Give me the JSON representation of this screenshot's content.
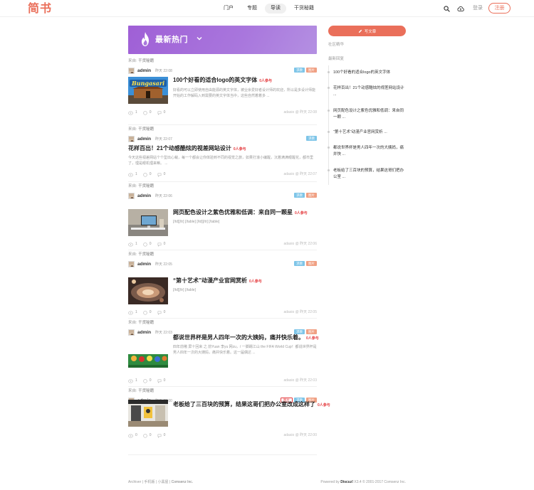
{
  "header": {
    "logo": "简书",
    "nav": [
      "门户",
      "专题",
      "导读",
      "干货秘籍"
    ],
    "active_nav": 2,
    "login": "登录",
    "register": "注册"
  },
  "banner": {
    "title": "最新热门"
  },
  "posts": [
    {
      "source_prefix": "来自: ",
      "source": "干货秘籍",
      "author": "admin",
      "time": "昨天 22:08",
      "tags": [
        {
          "text": "求教",
          "style": "blue"
        },
        {
          "text": "图片",
          "style": "orange"
        }
      ],
      "title": "100个好看的适合logo的英文字体",
      "hot": "0人参与",
      "excerpt": "好看的可以立即使用自由能源的英文字体，被业余爱好者设计师的欢迎，所以是多设计师能开始的工作解码入到需要的英文字体当中，这些自然着着多 ...",
      "likes": "1",
      "comments": "0",
      "views": "0",
      "footer": "adasio @ 昨天 22:08",
      "thumb": "bungasari"
    },
    {
      "source_prefix": "来自: ",
      "source": "干货秘籍",
      "author": "admin",
      "time": "昨天 22:07",
      "tags": [
        {
          "text": "求教",
          "style": "blue"
        }
      ],
      "title": "花样百出！21个动感酷炫的视差网站设计",
      "hot": "0人参与",
      "excerpt": "今天这些视差网站个个型出心裁，每一个都会让你体验到不同的视觉之旅，如果打滚小编醒，沉着满满眼醒花，都市里了，理是眼机理来嘛。 ...",
      "likes": "1",
      "comments": "0",
      "views": "0",
      "footer": "adasio @ 昨天 22:07",
      "thumb": ""
    },
    {
      "source_prefix": "来自: ",
      "source": "干货秘籍",
      "author": "admin",
      "time": "昨天 22:06",
      "tags": [
        {
          "text": "求教",
          "style": "blue"
        },
        {
          "text": "图片",
          "style": "orange"
        }
      ],
      "title": "网页配色设计之紫色优雅和低调：来自同一颗星",
      "hot": "0人参与",
      "excerpt": "[/td][/tr] [/table] [/td][/tr] [/table]",
      "likes": "1",
      "comments": "0",
      "views": "0",
      "footer": "adasio @ 昨天 22:06",
      "thumb": "office"
    },
    {
      "source_prefix": "来自: ",
      "source": "干货秘籍",
      "author": "admin",
      "time": "昨天 22:05",
      "tags": [
        {
          "text": "求教",
          "style": "blue"
        },
        {
          "text": "图片",
          "style": "orange"
        }
      ],
      "title": "“第十艺术”动漫产业官网赏析",
      "hot": "0人参与",
      "excerpt": "[/td][/tr] [/table]",
      "likes": "1",
      "comments": "0",
      "views": "0",
      "footer": "adasio @ 昨天 22:05",
      "thumb": "anime"
    },
    {
      "source_prefix": "来自: ",
      "source": "干货秘籍",
      "author": "admin",
      "time": "昨天 22:03",
      "tags": [
        {
          "text": "求教",
          "style": "blue"
        },
        {
          "text": "图片",
          "style": "orange"
        }
      ],
      "title": "都说世界杯是男人四年一次的大姨妈，痛并快乐着。",
      "hot": "0人参与",
      "excerpt": "四年前嗷 屏十回来 之 前Yuan 李yu 网zu，/ 一脚踢江山 the FIFA World Cup！都说世界杯是男人四年一次的大姨妈，痛并快乐着。这一届偶达 ...",
      "likes": "1",
      "comments": "0",
      "views": "0",
      "footer": "adasio @ 昨天 22:03",
      "thumb": "worldcup"
    },
    {
      "source_prefix": "来自: ",
      "source": "干货秘籍",
      "author": "admin",
      "time": "昨天 22:00",
      "tags": [
        {
          "text": "图片",
          "style": "red-outline"
        },
        {
          "text": "求教",
          "style": "blue"
        },
        {
          "text": "图片",
          "style": "orange"
        }
      ],
      "title": "老板给了三百块的预算，结果这哥们把办公室改成这样了",
      "hot": "0人参与",
      "excerpt": "",
      "likes": "0",
      "comments": "0",
      "views": "0",
      "footer": "adasio @ 昨天 22:00",
      "thumb": "interior"
    }
  ],
  "sidebar": {
    "write_label": "写文章",
    "community_title": "社区精华",
    "recent_title": "最新回复",
    "recent": [
      "100个好看的适合logo的英文字体",
      "花样百出！21个动感酷炫的视差网站设计 ...",
      "网页配色设计之紫色优雅和低调：来自同一颗 ...",
      "“第十艺术”动漫产业官网赏析 ...",
      "都说世界杯是男人四年一次的大姨妈，痛并快 ...",
      "老板给了三百块的预算，结果这哥们把办公室 ..."
    ]
  },
  "footer": {
    "left_links": "Archiver | 手机版 | 小黑屋 | ",
    "left_brand": "Comsenz Inc.",
    "right_prefix": "Powered by ",
    "right_brand": "Discuz!",
    "right_suffix": " X3.4 © 2001-2017 Comsenz Inc."
  },
  "thumb_text": {
    "bungasari": "Bungasari"
  },
  "colors": {
    "accent": "#ea6f5a",
    "banner": "#a977dd",
    "tag_blue": "#7ec5e8",
    "tag_orange": "#f0a083",
    "hot_red": "#e4393c"
  }
}
